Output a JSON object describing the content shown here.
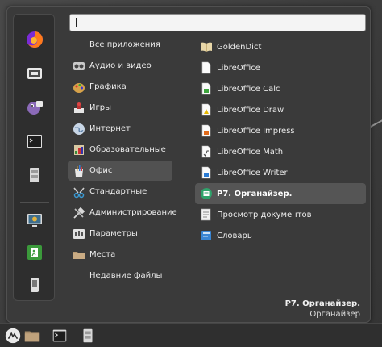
{
  "search": {
    "value": "",
    "placeholder": ""
  },
  "favorites": [
    {
      "icon": "firefox-icon"
    },
    {
      "icon": "software-manager-icon"
    },
    {
      "icon": "pidgin-icon"
    },
    {
      "icon": "terminal-icon"
    },
    {
      "icon": "file-manager-icon"
    },
    {
      "icon": "lock-screen-icon"
    },
    {
      "icon": "logout-icon"
    },
    {
      "icon": "shutdown-icon"
    }
  ],
  "categories": [
    {
      "label": "Все приложения",
      "icon": ""
    },
    {
      "label": "Аудио и видео",
      "icon": "multimedia-icon"
    },
    {
      "label": "Графика",
      "icon": "graphics-icon"
    },
    {
      "label": "Игры",
      "icon": "games-icon"
    },
    {
      "label": "Интернет",
      "icon": "internet-icon"
    },
    {
      "label": "Образовательные",
      "icon": "education-icon"
    },
    {
      "label": "Офис",
      "icon": "office-icon"
    },
    {
      "label": "Стандартные",
      "icon": "accessories-icon"
    },
    {
      "label": "Администрирование",
      "icon": "administration-icon"
    },
    {
      "label": "Параметры",
      "icon": "preferences-icon"
    },
    {
      "label": "Места",
      "icon": "places-folder-icon"
    },
    {
      "label": "Недавние файлы",
      "icon": ""
    }
  ],
  "active_category": "Офис",
  "apps": [
    {
      "label": "GoldenDict",
      "icon": "goldendict-icon"
    },
    {
      "label": "LibreOffice",
      "icon": "libreoffice-icon"
    },
    {
      "label": "LibreOffice Calc",
      "icon": "libreoffice-calc-icon"
    },
    {
      "label": "LibreOffice Draw",
      "icon": "libreoffice-draw-icon"
    },
    {
      "label": "LibreOffice Impress",
      "icon": "libreoffice-impress-icon"
    },
    {
      "label": "LibreOffice Math",
      "icon": "libreoffice-math-icon"
    },
    {
      "label": "LibreOffice Writer",
      "icon": "libreoffice-writer-icon"
    },
    {
      "label": "P7. Органайзер.",
      "icon": "p7-organizer-icon"
    },
    {
      "label": "Просмотр документов",
      "icon": "document-viewer-icon"
    },
    {
      "label": "Словарь",
      "icon": "dictionary-icon"
    }
  ],
  "selected_app": "P7. Органайзер.",
  "description": {
    "title": "P7. Органайзер.",
    "subtitle": "Органайзер"
  },
  "panel": [
    {
      "icon": "mint-menu-icon"
    },
    {
      "icon": "home-folder-icon"
    },
    {
      "icon": "terminal-icon"
    },
    {
      "icon": "file-cabinet-icon"
    }
  ],
  "colors": {
    "menu_bg": "#3a3a3a",
    "highlight": "#555555",
    "text": "#ececec",
    "panel_bg": "#2f2f2f"
  }
}
